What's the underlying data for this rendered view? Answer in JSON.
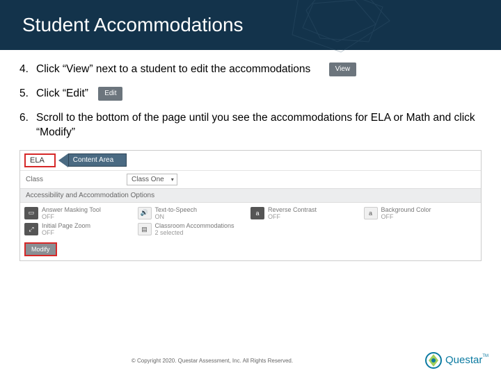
{
  "header": {
    "title": "Student Accommodations"
  },
  "steps": [
    {
      "num": "4.",
      "text": "Click “View” next to a student to edit the accommodations",
      "button": "View"
    },
    {
      "num": "5.",
      "text": "Click “Edit”",
      "button": "Edit"
    },
    {
      "num": "6.",
      "text": "Scroll to the bottom of the page until you see the accommodations for ELA or Math and click “Modify”",
      "button": null
    }
  ],
  "screenshot": {
    "ela_label": "ELA",
    "callout": "Content Area",
    "class_label": "Class",
    "class_value": "Class One",
    "section_header": "Accessibility and Accommodation Options",
    "options": [
      {
        "title": "Answer Masking Tool",
        "status": "OFF",
        "icon": "mask"
      },
      {
        "title": "Text-to-Speech",
        "status": "ON",
        "icon": "tts"
      },
      {
        "title": "Reverse Contrast",
        "status": "OFF",
        "icon": "contrast"
      },
      {
        "title": "Background Color",
        "status": "OFF",
        "icon": "bg"
      },
      {
        "title": "Initial Page Zoom",
        "status": "OFF",
        "icon": "zoom"
      },
      {
        "title": "Classroom Accommodations",
        "status": "2 selected",
        "icon": "class"
      }
    ],
    "modify_label": "Modify"
  },
  "footer": {
    "copyright": "© Copyright 2020. Questar Assessment, Inc. All Rights Reserved.",
    "logo_text": "Questar",
    "tm": "TM"
  }
}
